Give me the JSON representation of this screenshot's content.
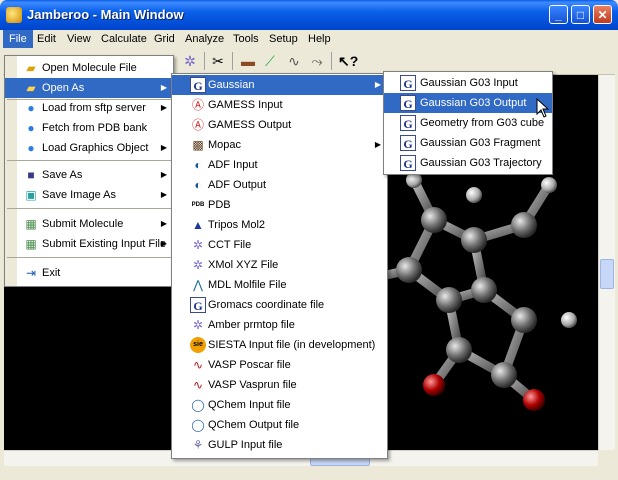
{
  "window": {
    "title": "Jamberoo - Main Window",
    "minimize": "_",
    "maximize": "□",
    "close": "✕"
  },
  "menubar": {
    "items": [
      "File",
      "Edit",
      "View",
      "Calculate",
      "Grid",
      "Analyze",
      "Tools",
      "Setup",
      "Help"
    ]
  },
  "toolbar": {
    "icons": [
      "molecule-icon",
      "scissors-icon",
      "bond-icon",
      "angle-icon",
      "dihedral-icon",
      "help-pointer-icon"
    ]
  },
  "file_menu": {
    "items": [
      {
        "label": "Open Molecule File",
        "icon": "folder-open-icon",
        "submenu": false
      },
      {
        "label": "Open As",
        "icon": "folder-icon",
        "submenu": true
      },
      {
        "label": "Load from sftp server",
        "icon": "globe-icon",
        "submenu": true
      },
      {
        "label": "Fetch from PDB bank",
        "icon": "globe-icon",
        "submenu": false
      },
      {
        "label": "Load Graphics Object",
        "icon": "globe-icon",
        "submenu": true
      },
      {
        "label": "Save As",
        "icon": "floppy-icon",
        "submenu": true
      },
      {
        "label": "Save Image As",
        "icon": "image-icon",
        "submenu": true
      },
      {
        "label": "Submit Molecule",
        "icon": "server-icon",
        "submenu": true
      },
      {
        "label": "Submit Existing Input File",
        "icon": "server-icon",
        "submenu": true
      },
      {
        "label": "Exit",
        "icon": "exit-icon",
        "submenu": false
      }
    ]
  },
  "open_as_menu": {
    "items": [
      {
        "label": "Gaussian",
        "submenu": true
      },
      {
        "label": "GAMESS Input"
      },
      {
        "label": "GAMESS Output"
      },
      {
        "label": "Mopac",
        "submenu": true
      },
      {
        "label": "ADF Input"
      },
      {
        "label": "ADF Output"
      },
      {
        "label": "PDB",
        "icon_text": "PDB"
      },
      {
        "label": "Tripos Mol2"
      },
      {
        "label": "CCT File"
      },
      {
        "label": "XMol XYZ File"
      },
      {
        "label": "MDL Molfile File"
      },
      {
        "label": "Gromacs coordinate file"
      },
      {
        "label": "Amber prmtop file"
      },
      {
        "label": "SIESTA Input file (in development)",
        "icon_text": "sie"
      },
      {
        "label": "VASP Poscar file"
      },
      {
        "label": "VASP Vasprun file"
      },
      {
        "label": "QChem Input file"
      },
      {
        "label": "QChem Output file"
      },
      {
        "label": "GULP Input file"
      }
    ]
  },
  "gaussian_menu": {
    "items": [
      {
        "label": "Gaussian G03 Input"
      },
      {
        "label": "Gaussian G03 Output"
      },
      {
        "label": "Geometry from G03 cube"
      },
      {
        "label": "Gaussian G03 Fragment"
      },
      {
        "label": "Gaussian G03 Trajectory"
      }
    ]
  },
  "colors": {
    "highlight": "#316ac5",
    "titlebar": "#0a5ce6",
    "canvas": "#000000",
    "carbon": "#8a8a8a",
    "hydrogen": "#d0d0d0",
    "oxygen": "#c01010"
  }
}
